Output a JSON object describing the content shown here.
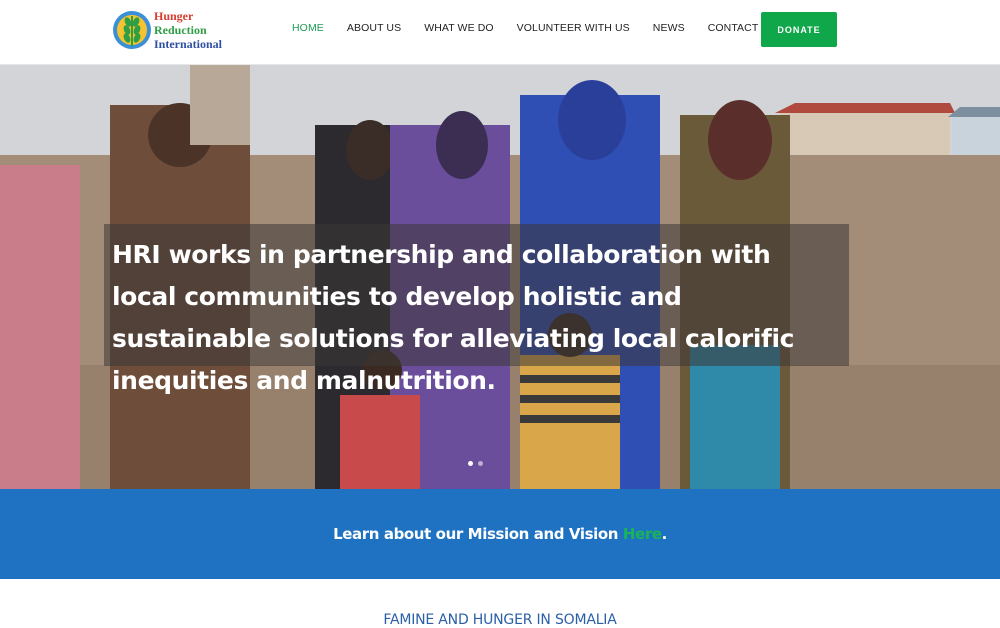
{
  "brand": {
    "line1": "Hunger",
    "line2": "Reduction",
    "line3": "International"
  },
  "nav": {
    "items": [
      {
        "label": "HOME"
      },
      {
        "label": "ABOUT US"
      },
      {
        "label": "WHAT WE DO"
      },
      {
        "label": "VOLUNTEER WITH US"
      },
      {
        "label": "NEWS"
      },
      {
        "label": "CONTACT WITH US"
      }
    ],
    "active_index": 0,
    "donate_label": "DONATE"
  },
  "hero": {
    "caption": "HRI works in partnership and collaboration with local communities to develop holistic and sustainable solutions for alleviating local calorific inequities and malnutrition.",
    "slides": 2,
    "current_slide": 1
  },
  "mission": {
    "text": "Learn about our Mission and Vision ",
    "link_label": "Here",
    "suffix": "."
  },
  "section": {
    "title": "FAMINE AND HUNGER IN SOMALIA"
  },
  "colors": {
    "accent_green": "#10a64a",
    "nav_active": "#1e9a55",
    "mission_bg": "#1f72c1",
    "section_title": "#2b5fa8"
  }
}
